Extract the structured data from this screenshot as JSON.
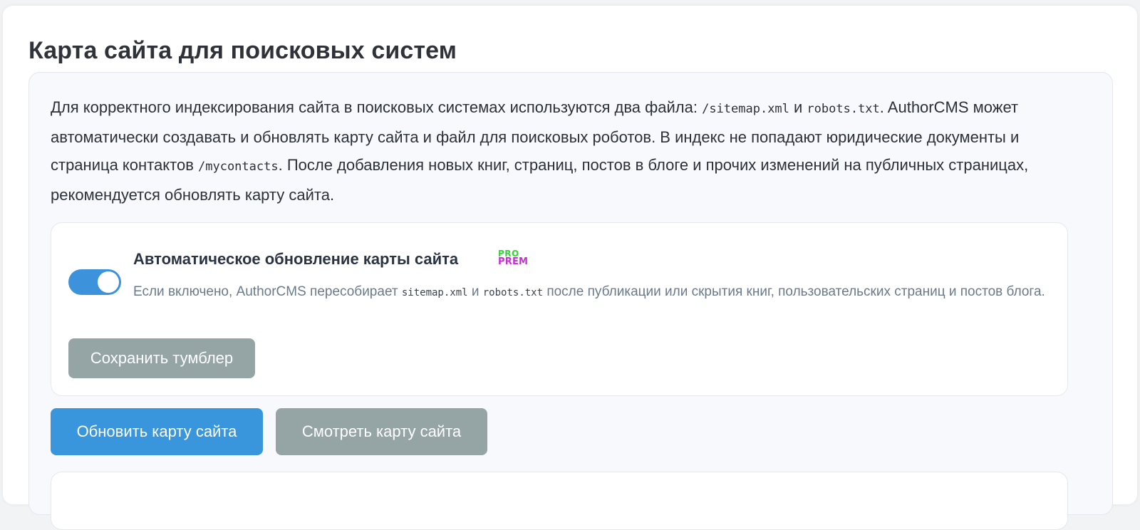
{
  "page": {
    "title": "Карта сайта для поисковых систем"
  },
  "intro": {
    "part1": "Для корректного индексирования сайта в поисковых системах используются два файла: ",
    "code_sitemap": "/sitemap.xml",
    "and1": " и ",
    "code_robots": "robots.txt",
    "part2": ". AuthorCMS может автоматически создавать и обновлять карту сайта и файл для поисковых роботов. В индекс не попадают юридические документы и страница контактов ",
    "code_contacts": "/mycontacts",
    "part3": ". После добавления новых книг, страниц, постов в блоге и прочих изменений на публичных страницах, рекомендуется обновлять карту сайта."
  },
  "auto_update": {
    "enabled": true,
    "title": "Автоматическое обновление карты сайта",
    "badge_pro": "PRO",
    "badge_prem": "PREM",
    "desc_part1": "Если включено, AuthorCMS пересобирает ",
    "desc_code_sitemap": "sitemap.xml",
    "desc_and": " и ",
    "desc_code_robots": "robots.txt",
    "desc_part2": " после публикации или скрытия книг, пользовательских страниц и постов блога.",
    "save_label": "Сохранить тумблер"
  },
  "actions": {
    "update_label": "Обновить карту сайта",
    "view_label": "Смотреть карту сайта"
  },
  "colors": {
    "accent": "#3a96dc",
    "muted_button": "#95a5a5",
    "pro_badge": "#33d633",
    "prem_badge": "#c42fd6"
  }
}
